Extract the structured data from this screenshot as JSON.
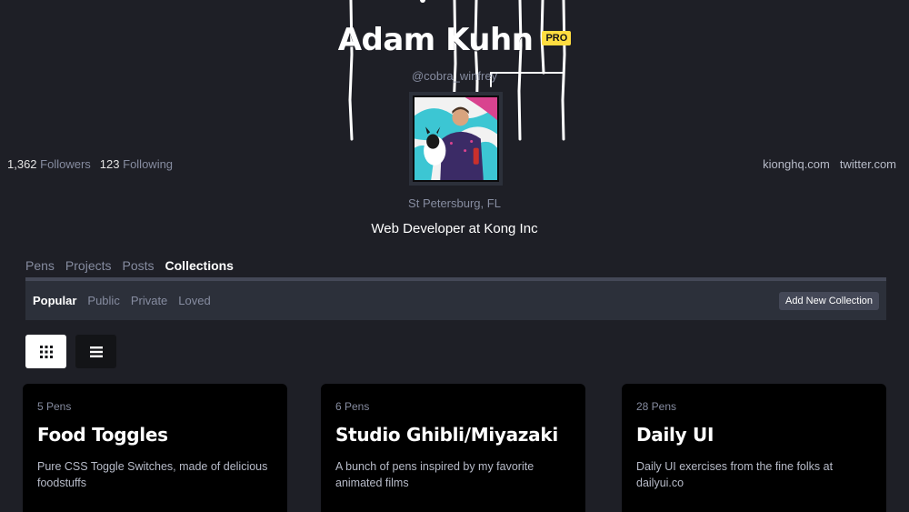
{
  "profile": {
    "name": "Adam Kuhn",
    "badge": "PRO",
    "handle": "@cobra_winfrey",
    "followers_count": "1,362",
    "followers_label": "Followers",
    "following_count": "123",
    "following_label": "Following",
    "location": "St Petersburg, FL",
    "bio": "Web Developer at Kong Inc",
    "links": [
      "kionghq.com",
      "twitter.com"
    ]
  },
  "tabs": [
    "Pens",
    "Projects",
    "Posts",
    "Collections"
  ],
  "active_tab": "Collections",
  "sub_tabs": [
    "Popular",
    "Public",
    "Private",
    "Loved"
  ],
  "active_sub_tab": "Popular",
  "add_button": "Add New Collection",
  "view_icons": {
    "grid": "grid-icon",
    "list": "list-icon"
  },
  "collections": [
    {
      "count": "5 Pens",
      "title": "Food Toggles",
      "description": "Pure CSS Toggle Switches, made of delicious foodstuffs"
    },
    {
      "count": "6 Pens",
      "title": "Studio Ghibli/Miyazaki",
      "description": "A bunch of pens inspired by my favorite animated films"
    },
    {
      "count": "28 Pens",
      "title": "Daily UI",
      "description": "Daily UI exercises from the fine folks at dailyui.co"
    }
  ],
  "colors": {
    "background": "#1e1f26",
    "badge": "#ffdd40",
    "card": "#000000",
    "muted_text": "#868ca0",
    "subbar": "#2c303a"
  }
}
